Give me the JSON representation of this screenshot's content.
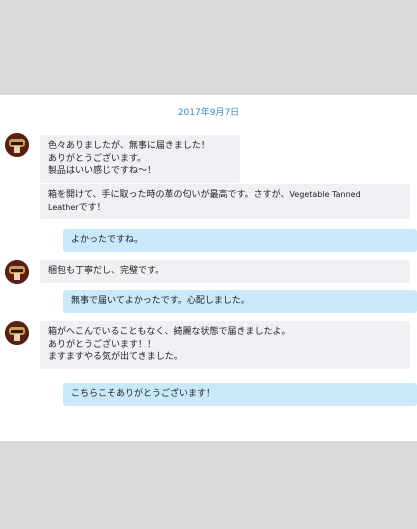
{
  "chat": {
    "date": "2017年9月7日",
    "messages": [
      {
        "direction": "in",
        "text": "色々ありましたが、無事に届きました！\nありがとうございます。\n製品はいい感じですね～！"
      },
      {
        "direction": "in",
        "text_part1": "箱を開けて、手に取った時の革の匂いが最高です。さすが、",
        "text_latin_1": "Vegetable Tanned",
        "text_latin_2": "Leather",
        "text_part2": "です！"
      },
      {
        "direction": "out",
        "text": "よかったですね。"
      },
      {
        "direction": "in",
        "text": "梱包も丁寧だし、完璧です。"
      },
      {
        "direction": "out",
        "text": "無事で届いてよかったです。心配しました。"
      },
      {
        "direction": "in",
        "text": "箱がへこんでいることもなく、綺麗な状態で届きましたよ。\nありがとうございます！！\nますますやる気が出てきました。"
      },
      {
        "direction": "out",
        "text": "こちらこそありがとうございます！"
      }
    ]
  },
  "colors": {
    "page_background": "#d9d9d9",
    "chat_background": "#ffffff",
    "incoming_bubble": "#eef0f3",
    "outgoing_bubble": "#c9e9fb",
    "date_text": "#3a86c8",
    "avatar": "#5a1e14"
  },
  "icons": {
    "avatar": "user-avatar-icon"
  }
}
